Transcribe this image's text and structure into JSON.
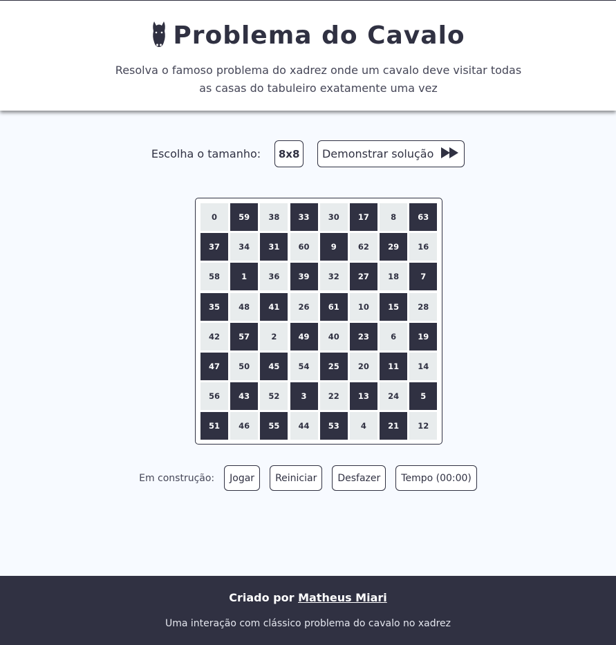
{
  "header": {
    "title": "Problema do Cavalo",
    "icon": "knight-icon",
    "subtitle": "Resolva o famoso problema do xadrez onde um cavalo deve visitar todas as casas do tabuleiro exatamente uma vez"
  },
  "size_selector": {
    "label": "Escolha o tamanho:",
    "value": "8x8",
    "demo_label": "Demonstrar solução",
    "demo_icon": "fast-forward-icon"
  },
  "board": {
    "rows": [
      [
        "0",
        "59",
        "38",
        "33",
        "30",
        "17",
        "8",
        "63"
      ],
      [
        "37",
        "34",
        "31",
        "60",
        "9",
        "62",
        "29",
        "16"
      ],
      [
        "58",
        "1",
        "36",
        "39",
        "32",
        "27",
        "18",
        "7"
      ],
      [
        "35",
        "48",
        "41",
        "26",
        "61",
        "10",
        "15",
        "28"
      ],
      [
        "42",
        "57",
        "2",
        "49",
        "40",
        "23",
        "6",
        "19"
      ],
      [
        "47",
        "50",
        "45",
        "54",
        "25",
        "20",
        "11",
        "14"
      ],
      [
        "56",
        "43",
        "52",
        "3",
        "22",
        "13",
        "24",
        "5"
      ],
      [
        "51",
        "46",
        "55",
        "44",
        "53",
        "4",
        "21",
        "12"
      ]
    ],
    "colors": {
      "light": "#e8eced",
      "dark": "#303142"
    }
  },
  "controls": {
    "label": "Em construção:",
    "play": "Jogar",
    "restart": "Reiniciar",
    "undo": "Desfazer",
    "timer": "Tempo (00:00)"
  },
  "footer": {
    "credit_prefix": "Criado por",
    "author": "Matheus Miari",
    "description": "Uma interação com clássico problema do cavalo no xadrez"
  },
  "colors": {
    "primary": "#303142",
    "background": "#f7faff"
  }
}
